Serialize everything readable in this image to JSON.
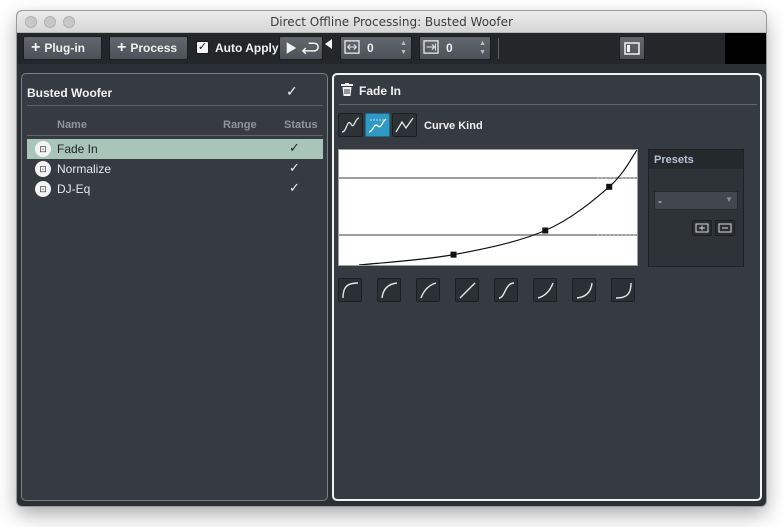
{
  "window": {
    "title": "Direct Offline Processing: Busted Woofer"
  },
  "toolbar": {
    "plugin_label": "Plug-in",
    "process_label": "Process",
    "auto_apply_label": "Auto Apply",
    "auto_apply_checked": true,
    "pre_value": "0",
    "post_value": "0",
    "icons": [
      "plus-icon",
      "play-icon",
      "loop-icon",
      "pre-range-icon",
      "post-range-icon",
      "panel-layout-icon"
    ]
  },
  "left_panel": {
    "title": "Busted Woofer",
    "columns": [
      "Name",
      "Range",
      "Status"
    ],
    "rows": [
      {
        "name": "Fade In",
        "selected": true,
        "status": "✓"
      },
      {
        "name": "Normalize",
        "selected": false,
        "status": "✓"
      },
      {
        "name": "DJ-Eq",
        "selected": false,
        "status": "✓"
      }
    ]
  },
  "right_panel": {
    "title": "Fade In",
    "curve_kind_label": "Curve Kind",
    "curve_kind_selected": 1,
    "presets": {
      "header": "Presets",
      "selected": "-"
    },
    "curve": {
      "points": [
        [
          0.0,
          0.0
        ],
        [
          0.34,
          0.09
        ],
        [
          0.67,
          0.3
        ],
        [
          0.9,
          0.68
        ],
        [
          1.0,
          1.0
        ]
      ]
    },
    "shape_presets": [
      "convex-strong-icon",
      "convex-icon",
      "convex-soft-icon",
      "linear-icon",
      "s-curve-icon",
      "concave-soft-icon",
      "concave-icon",
      "concave-strong-icon"
    ]
  },
  "colors": {
    "accent": "#2f9ac4",
    "selected_row": "#a9c5b9",
    "panel_bg": "#353b40",
    "window_bg": "#2b3034"
  }
}
